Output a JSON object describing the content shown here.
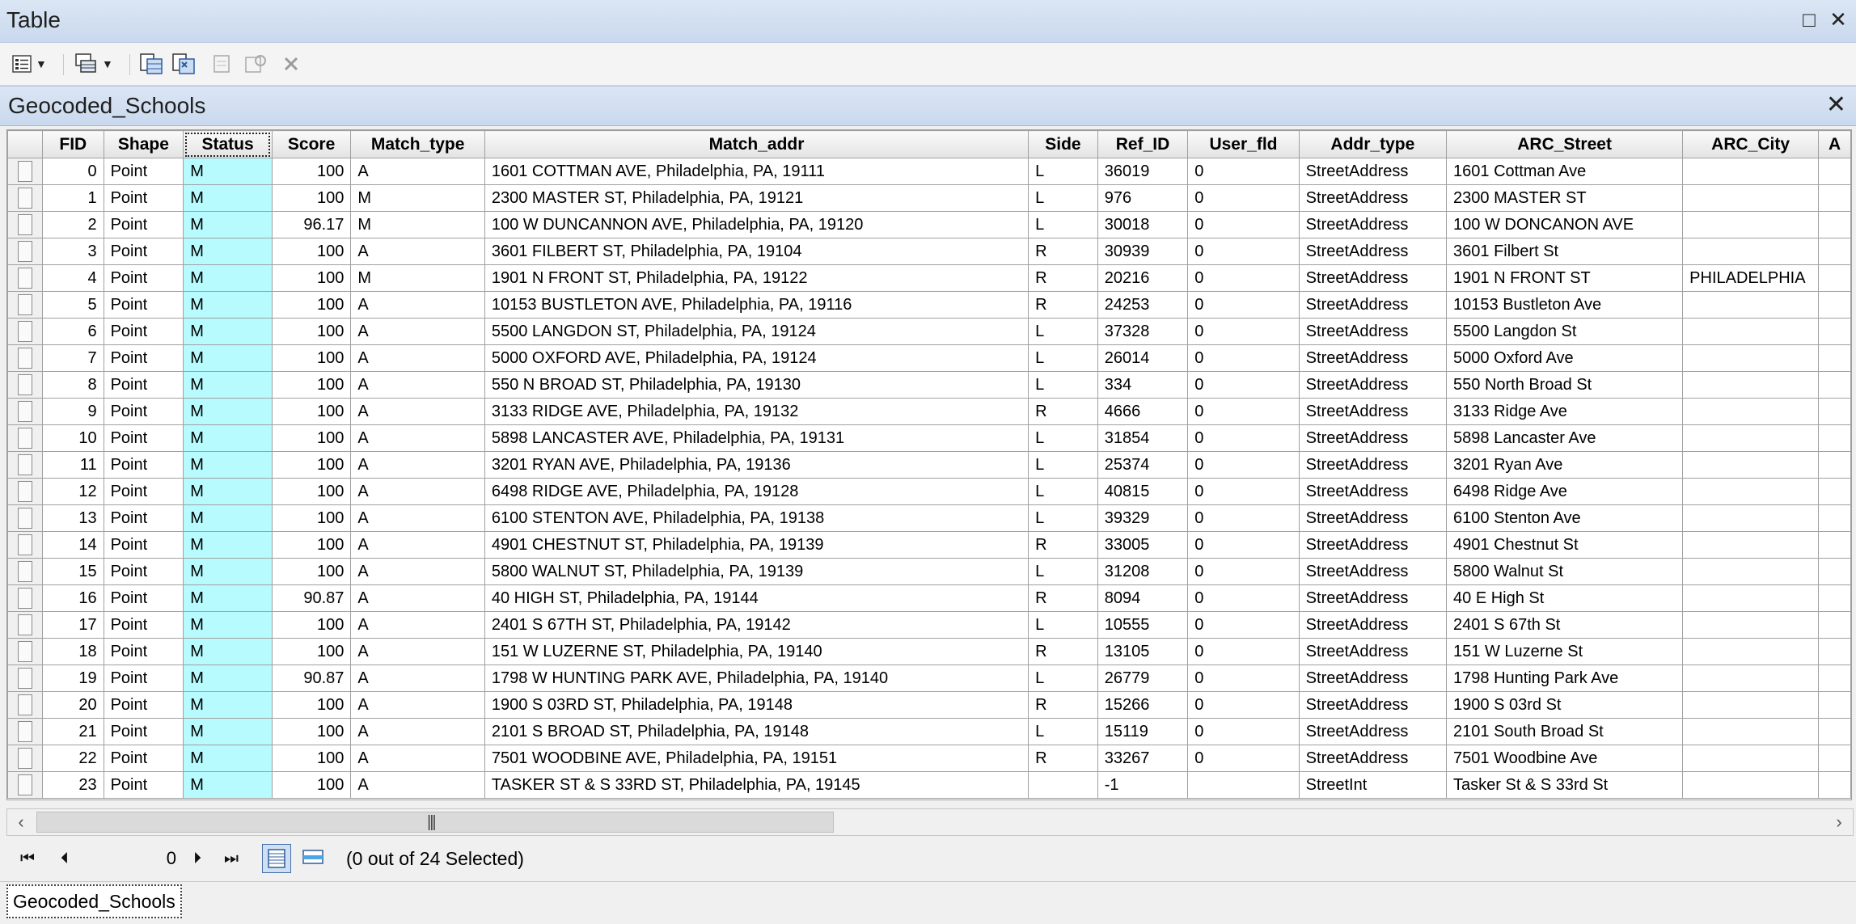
{
  "window": {
    "title": "Table"
  },
  "toolbar": {
    "items": [
      {
        "name": "table-options-icon",
        "has_dropdown": true
      },
      {
        "name": "related-tables-icon",
        "has_dropdown": true
      },
      {
        "name": "select-by-attributes-icon"
      },
      {
        "name": "switch-selection-icon"
      },
      {
        "name": "clear-selection-icon"
      },
      {
        "name": "zoom-to-selected-icon"
      },
      {
        "name": "delete-selected-icon"
      }
    ]
  },
  "tab": {
    "title": "Geocoded_Schools"
  },
  "grid": {
    "columns": [
      "FID",
      "Shape",
      "Status",
      "Score",
      "Match_type",
      "Match_addr",
      "Side",
      "Ref_ID",
      "User_fld",
      "Addr_type",
      "ARC_Street",
      "ARC_City",
      "A"
    ],
    "rows": [
      [
        "0",
        "Point",
        "M",
        "100",
        "A",
        "1601 COTTMAN AVE, Philadelphia, PA, 19111",
        "L",
        "36019",
        "0",
        "StreetAddress",
        "1601 Cottman Ave",
        ""
      ],
      [
        "1",
        "Point",
        "M",
        "100",
        "M",
        "2300 MASTER ST, Philadelphia, PA, 19121",
        "L",
        "976",
        "0",
        "StreetAddress",
        "2300 MASTER ST",
        ""
      ],
      [
        "2",
        "Point",
        "M",
        "96.17",
        "M",
        "100 W DUNCANNON AVE, Philadelphia, PA, 19120",
        "L",
        "30018",
        "0",
        "StreetAddress",
        "100 W DONCANON AVE",
        ""
      ],
      [
        "3",
        "Point",
        "M",
        "100",
        "A",
        "3601 FILBERT ST, Philadelphia, PA, 19104",
        "R",
        "30939",
        "0",
        "StreetAddress",
        "3601 Filbert St",
        ""
      ],
      [
        "4",
        "Point",
        "M",
        "100",
        "M",
        "1901 N FRONT ST, Philadelphia, PA, 19122",
        "R",
        "20216",
        "0",
        "StreetAddress",
        "1901 N FRONT ST",
        "PHILADELPHIA"
      ],
      [
        "5",
        "Point",
        "M",
        "100",
        "A",
        "10153 BUSTLETON AVE, Philadelphia, PA, 19116",
        "R",
        "24253",
        "0",
        "StreetAddress",
        "10153 Bustleton Ave",
        ""
      ],
      [
        "6",
        "Point",
        "M",
        "100",
        "A",
        "5500 LANGDON ST, Philadelphia, PA, 19124",
        "L",
        "37328",
        "0",
        "StreetAddress",
        "5500 Langdon St",
        ""
      ],
      [
        "7",
        "Point",
        "M",
        "100",
        "A",
        "5000 OXFORD AVE, Philadelphia, PA, 19124",
        "L",
        "26014",
        "0",
        "StreetAddress",
        "5000 Oxford Ave",
        ""
      ],
      [
        "8",
        "Point",
        "M",
        "100",
        "A",
        "550 N BROAD ST, Philadelphia, PA, 19130",
        "L",
        "334",
        "0",
        "StreetAddress",
        "550 North Broad St",
        ""
      ],
      [
        "9",
        "Point",
        "M",
        "100",
        "A",
        "3133 RIDGE AVE, Philadelphia, PA, 19132",
        "R",
        "4666",
        "0",
        "StreetAddress",
        "3133 Ridge Ave",
        ""
      ],
      [
        "10",
        "Point",
        "M",
        "100",
        "A",
        "5898 LANCASTER AVE, Philadelphia, PA, 19131",
        "L",
        "31854",
        "0",
        "StreetAddress",
        "5898 Lancaster Ave",
        ""
      ],
      [
        "11",
        "Point",
        "M",
        "100",
        "A",
        "3201 RYAN AVE, Philadelphia, PA, 19136",
        "L",
        "25374",
        "0",
        "StreetAddress",
        "3201 Ryan Ave",
        ""
      ],
      [
        "12",
        "Point",
        "M",
        "100",
        "A",
        "6498 RIDGE AVE, Philadelphia, PA, 19128",
        "L",
        "40815",
        "0",
        "StreetAddress",
        "6498 Ridge Ave",
        ""
      ],
      [
        "13",
        "Point",
        "M",
        "100",
        "A",
        "6100 STENTON AVE, Philadelphia, PA, 19138",
        "L",
        "39329",
        "0",
        "StreetAddress",
        "6100 Stenton Ave",
        ""
      ],
      [
        "14",
        "Point",
        "M",
        "100",
        "A",
        "4901 CHESTNUT ST, Philadelphia, PA, 19139",
        "R",
        "33005",
        "0",
        "StreetAddress",
        "4901 Chestnut St",
        ""
      ],
      [
        "15",
        "Point",
        "M",
        "100",
        "A",
        "5800 WALNUT ST, Philadelphia, PA, 19139",
        "L",
        "31208",
        "0",
        "StreetAddress",
        "5800  Walnut St",
        ""
      ],
      [
        "16",
        "Point",
        "M",
        "90.87",
        "A",
        "40 HIGH ST, Philadelphia, PA, 19144",
        "R",
        "8094",
        "0",
        "StreetAddress",
        "40 E High St",
        ""
      ],
      [
        "17",
        "Point",
        "M",
        "100",
        "A",
        "2401 S 67TH ST, Philadelphia, PA, 19142",
        "L",
        "10555",
        "0",
        "StreetAddress",
        "2401 S 67th St",
        ""
      ],
      [
        "18",
        "Point",
        "M",
        "100",
        "A",
        "151 W LUZERNE ST, Philadelphia, PA, 19140",
        "R",
        "13105",
        "0",
        "StreetAddress",
        "151 W Luzerne St",
        ""
      ],
      [
        "19",
        "Point",
        "M",
        "90.87",
        "A",
        "1798 W HUNTING PARK AVE, Philadelphia, PA, 19140",
        "L",
        "26779",
        "0",
        "StreetAddress",
        "1798 Hunting Park Ave",
        ""
      ],
      [
        "20",
        "Point",
        "M",
        "100",
        "A",
        "1900 S 03RD ST, Philadelphia, PA, 19148",
        "R",
        "15266",
        "0",
        "StreetAddress",
        "1900 S 03rd St",
        ""
      ],
      [
        "21",
        "Point",
        "M",
        "100",
        "A",
        "2101 S BROAD ST, Philadelphia, PA, 19148",
        "L",
        "15119",
        "0",
        "StreetAddress",
        "2101 South Broad St",
        ""
      ],
      [
        "22",
        "Point",
        "M",
        "100",
        "A",
        "7501 WOODBINE AVE, Philadelphia, PA, 19151",
        "R",
        "33267",
        "0",
        "StreetAddress",
        "7501 Woodbine Ave",
        ""
      ],
      [
        "23",
        "Point",
        "M",
        "100",
        "A",
        "TASKER ST & S 33RD ST, Philadelphia, PA, 19145",
        "",
        "-1",
        "",
        "StreetInt",
        "Tasker St & S 33rd St",
        ""
      ]
    ]
  },
  "navigation": {
    "current_record": "0",
    "selection_text": "(0 out of 24 Selected)"
  },
  "bottom_tab": {
    "label": "Geocoded_Schools"
  },
  "colors": {
    "status_highlight": "#b7fbff",
    "titlebar": "#c9d9ee"
  }
}
